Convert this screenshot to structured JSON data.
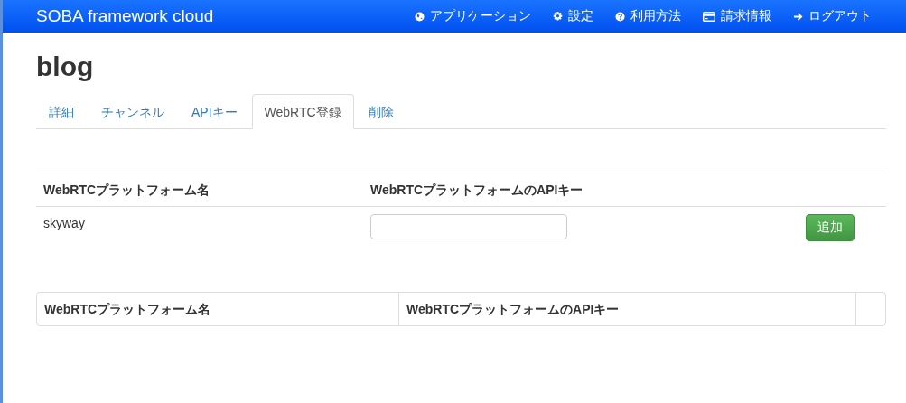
{
  "navbar": {
    "brand": "SOBA framework cloud",
    "items": [
      {
        "label": "アプリケーション"
      },
      {
        "label": "設定"
      },
      {
        "label": "利用方法"
      },
      {
        "label": "請求情報"
      },
      {
        "label": "ログアウト"
      }
    ]
  },
  "page_title": "blog",
  "tabs": [
    {
      "label": "詳細",
      "selected": false
    },
    {
      "label": "チャンネル",
      "selected": false
    },
    {
      "label": "APIキー",
      "selected": false
    },
    {
      "label": "WebRTC登録",
      "selected": true
    },
    {
      "label": "削除",
      "selected": false
    }
  ],
  "form_table": {
    "columns": [
      "WebRTCプラットフォーム名",
      "WebRTCプラットフォームのAPIキー"
    ],
    "row": {
      "platform": "skyway",
      "add_button": "追加"
    }
  },
  "registered_table": {
    "columns": [
      "WebRTCプラットフォーム名",
      "WebRTCプラットフォームのAPIキー"
    ]
  }
}
